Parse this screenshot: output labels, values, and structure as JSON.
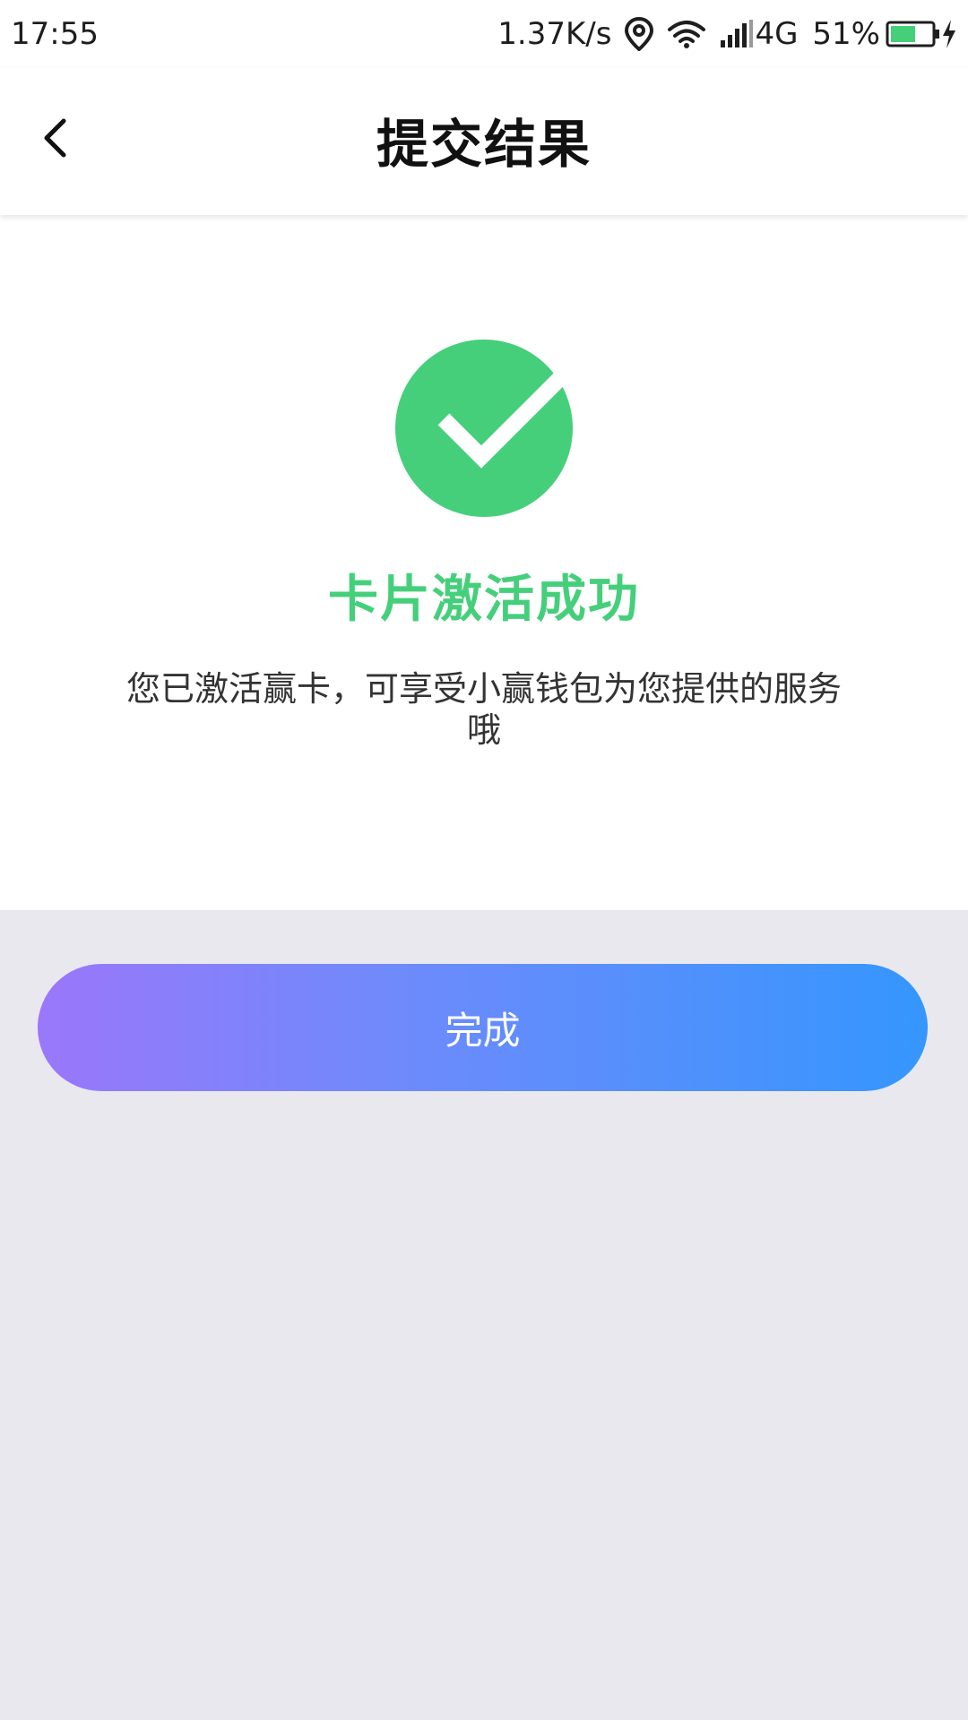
{
  "status_bar": {
    "time": "17:55",
    "network_speed": "1.37K/s",
    "network_type": "4G",
    "battery": "51%",
    "icons": [
      "location-icon",
      "wifi-icon",
      "signal-icon",
      "battery-icon",
      "charging-icon"
    ]
  },
  "header": {
    "title": "提交结果",
    "back_icon": "chevron-left-icon"
  },
  "result": {
    "icon": "check-circle-icon",
    "title": "卡片激活成功",
    "description": "您已激活赢卡，可享受小赢钱包为您提供的服务哦"
  },
  "actions": {
    "done_label": "完成"
  },
  "colors": {
    "success": "#45cf7b",
    "button_gradient_start": "#9a77fb",
    "button_gradient_end": "#3596fe",
    "page_background": "#e9e8ef"
  }
}
